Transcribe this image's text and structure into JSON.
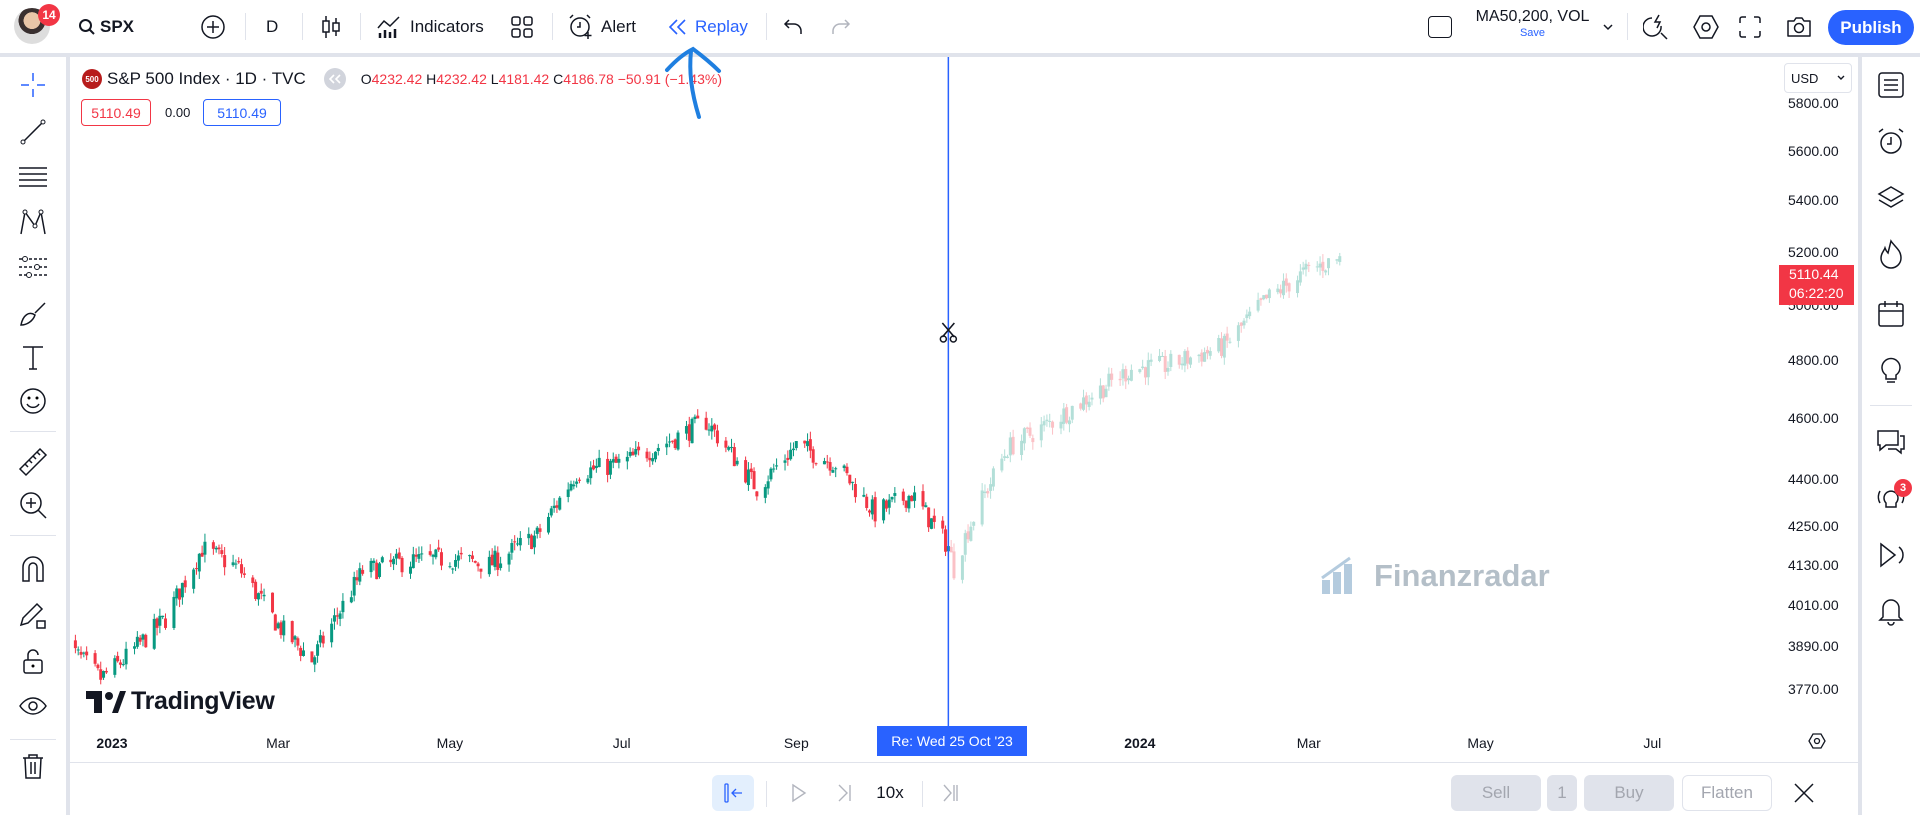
{
  "topbar": {
    "notifications": "14",
    "symbol": "SPX",
    "interval": "D",
    "indicators": "Indicators",
    "alert": "Alert",
    "replay": "Replay",
    "layout_name": "MA50,200, VOL",
    "save": "Save",
    "publish": "Publish"
  },
  "legend": {
    "title": "S&P 500 Index · 1D · TVC",
    "logo": "500",
    "o_label": "O",
    "o": "4232.42",
    "h_label": "H",
    "h": "4232.42",
    "l_label": "L",
    "l": "4181.42",
    "c_label": "C",
    "c": "4186.78",
    "change": "−50.91 (−1.43%)",
    "bid": "5110.49",
    "spread": "0.00",
    "ask": "5110.49"
  },
  "currency": "USD",
  "last_price": {
    "value": "5110.44",
    "countdown": "06:22:20"
  },
  "replay_date": "Re: Wed 25 Oct '23",
  "watermark": "Finanzradar",
  "brand": "TradingView",
  "bottombar": {
    "speed": "10x",
    "sell": "Sell",
    "qty": "1",
    "buy": "Buy",
    "flatten": "Flatten"
  },
  "right_badge": "3",
  "colors": {
    "up": "#089981",
    "down": "#f23645",
    "accent": "#2962ff",
    "replay_line": "#2962ff"
  },
  "chart_data": {
    "type": "candlestick",
    "y_scale": "log",
    "ylim": [
      3740,
      5850
    ],
    "y_ticks": [
      "5800.00",
      "5600.00",
      "5400.00",
      "5200.00",
      "5000.00",
      "4800.00",
      "4600.00",
      "4400.00",
      "4250.00",
      "4130.00",
      "4010.00",
      "3890.00",
      "3770.00"
    ],
    "x_ticks": [
      {
        "label": "2023",
        "date": "2023-01-01"
      },
      {
        "label": "Mar",
        "date": "2023-03-01"
      },
      {
        "label": "May",
        "date": "2023-05-01"
      },
      {
        "label": "Jul",
        "date": "2023-07-01"
      },
      {
        "label": "Sep",
        "date": "2023-09-01"
      },
      {
        "label": "2024",
        "date": "2024-01-01"
      },
      {
        "label": "Mar",
        "date": "2024-03-01"
      },
      {
        "label": "May",
        "date": "2024-05-01"
      },
      {
        "label": "Jul",
        "date": "2024-07-01"
      }
    ],
    "replay_cutoff": "2023-10-25",
    "approx_close": [
      [
        "2022-12-15",
        3900
      ],
      [
        "2022-12-28",
        3800
      ],
      [
        "2023-01-05",
        3850
      ],
      [
        "2023-01-20",
        3970
      ],
      [
        "2023-02-02",
        4180
      ],
      [
        "2023-02-15",
        4120
      ],
      [
        "2023-03-01",
        3950
      ],
      [
        "2023-03-13",
        3850
      ],
      [
        "2023-03-31",
        4110
      ],
      [
        "2023-04-15",
        4140
      ],
      [
        "2023-05-01",
        4150
      ],
      [
        "2023-05-15",
        4130
      ],
      [
        "2023-06-01",
        4220
      ],
      [
        "2023-06-15",
        4420
      ],
      [
        "2023-07-01",
        4450
      ],
      [
        "2023-07-15",
        4510
      ],
      [
        "2023-07-31",
        4590
      ],
      [
        "2023-08-18",
        4370
      ],
      [
        "2023-09-01",
        4510
      ],
      [
        "2023-09-15",
        4450
      ],
      [
        "2023-09-29",
        4290
      ],
      [
        "2023-10-12",
        4350
      ],
      [
        "2023-10-25",
        4186.78
      ],
      [
        "2023-10-27",
        4120
      ],
      [
        "2023-11-01",
        4240
      ],
      [
        "2023-11-15",
        4500
      ],
      [
        "2023-12-01",
        4590
      ],
      [
        "2023-12-29",
        4770
      ],
      [
        "2024-01-10",
        4780
      ],
      [
        "2024-01-31",
        4850
      ],
      [
        "2024-02-15",
        5020
      ],
      [
        "2024-03-01",
        5130
      ],
      [
        "2024-03-12",
        5175
      ]
    ]
  }
}
